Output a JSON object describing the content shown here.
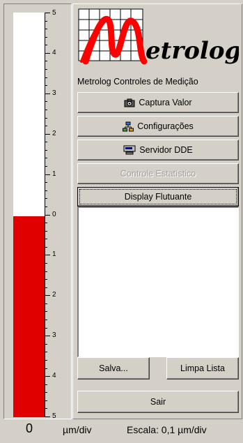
{
  "gauge": {
    "value": 0,
    "fill_fraction": 0.497,
    "bar_color": "#e00000",
    "scale_labels": [
      "5",
      "4",
      "3",
      "2",
      "1",
      "0",
      "1",
      "2",
      "3",
      "4",
      "5"
    ]
  },
  "logo": {
    "wordmark": "etrolog",
    "caption": "Metrolog Controles de Medição",
    "accent_color": "#ff0000"
  },
  "buttons": {
    "captura": {
      "label": "Captura Valor",
      "icon": "camera-icon"
    },
    "config": {
      "label": "Configurações",
      "icon": "network-icon"
    },
    "servidor": {
      "label": "Servidor DDE",
      "icon": "server-icon"
    },
    "controle": {
      "label": "Controle Estatístico",
      "disabled": true
    },
    "display": {
      "label": "Display Flutuante",
      "focused": true
    },
    "salva": {
      "label": "Salva..."
    },
    "limpa": {
      "label": "Limpa Lista"
    },
    "sair": {
      "label": "Sair"
    }
  },
  "status": {
    "reading": "0",
    "unit": "µm/div",
    "scale": "Escala: 0,1 µm/div"
  }
}
